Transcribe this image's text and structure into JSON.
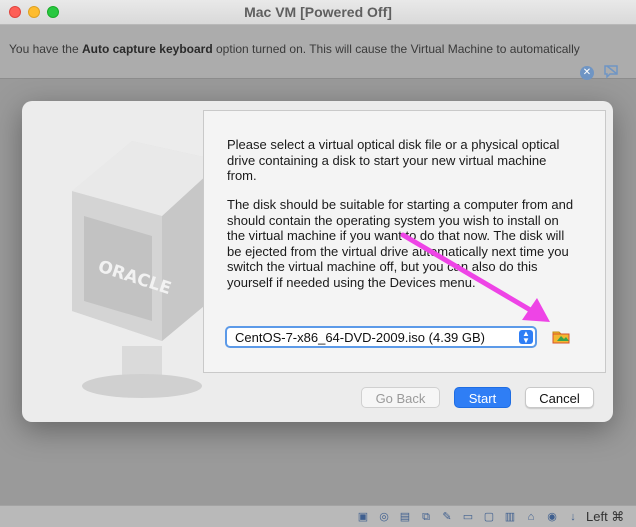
{
  "window": {
    "title": "Mac VM [Powered Off]"
  },
  "notice": {
    "prefix": "You have the ",
    "bold": "Auto capture keyboard",
    "suffix": " option turned on. This will cause the Virtual Machine to automatically"
  },
  "dialog": {
    "paragraph1": "Please select a virtual optical disk file or a physical optical drive containing a disk to start your new virtual machine from.",
    "paragraph2": "The disk should be suitable for starting a computer from and should contain the operating system you wish to install on the virtual machine if you want to do that now. The disk will be ejected from the virtual drive automatically next time you switch the virtual machine off, but you can also do this yourself if needed using the Devices menu.",
    "disk_select": {
      "value": "CentOS-7-x86_64-DVD-2009.iso (4.39 GB)"
    },
    "buttons": {
      "back": "Go Back",
      "start": "Start",
      "cancel": "Cancel"
    },
    "logo_text": "ORACLE"
  },
  "statusbar": {
    "host_key": "Left ⌘"
  },
  "colors": {
    "accent": "#2f7ef5",
    "annotation_arrow": "#ee44e6"
  }
}
